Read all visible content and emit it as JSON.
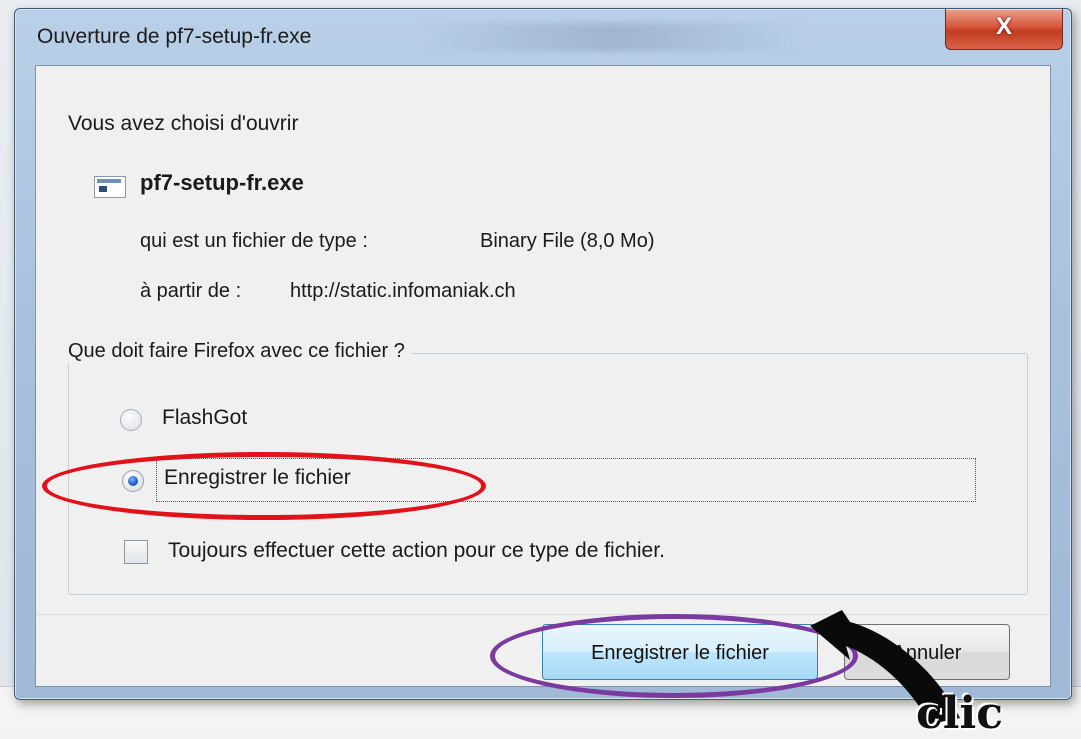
{
  "window": {
    "title": "Ouverture de pf7-setup-fr.exe",
    "close_glyph": "X"
  },
  "dialog": {
    "intro": "Vous avez choisi d'ouvrir",
    "filename": "pf7-setup-fr.exe",
    "file_icon": "exe-file-icon",
    "type_label": "qui est un fichier de type :",
    "type_value": "Binary File (8,0 Mo)",
    "from_label": "à partir de :",
    "from_value": "http://static.infomaniak.ch"
  },
  "action_group": {
    "legend": "Que doit faire Firefox avec ce fichier ?",
    "options": [
      {
        "label": "FlashGot",
        "selected": false
      },
      {
        "label": "Enregistrer le fichier",
        "selected": true
      }
    ],
    "always_label": "Toujours effectuer cette action pour ce type de fichier.",
    "always_checked": false
  },
  "buttons": {
    "save": "Enregistrer le fichier",
    "cancel": "Annuler"
  },
  "annotations": {
    "highlight_color_red": "#e2121b",
    "highlight_color_purple": "#7a3aa0",
    "arrow_text": "clic"
  }
}
